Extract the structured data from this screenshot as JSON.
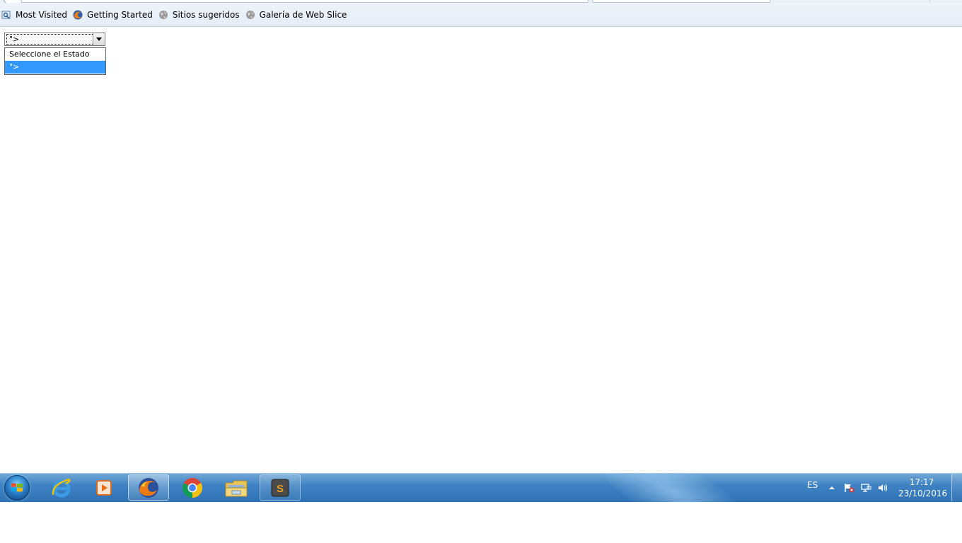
{
  "bookmarks": [
    {
      "label": "Most Visited",
      "icon": "most-visited-icon"
    },
    {
      "label": "Getting Started",
      "icon": "firefox-icon"
    },
    {
      "label": "Sitios sugeridos",
      "icon": "globe-icon"
    },
    {
      "label": "Galería de Web Slice",
      "icon": "globe-icon"
    }
  ],
  "select": {
    "current_value": "\">",
    "options": [
      "Seleccione el Estado",
      "\">"
    ],
    "selected_index": 1
  },
  "taskbar": {
    "apps": [
      {
        "name": "internet-explorer-icon",
        "state": "pinned"
      },
      {
        "name": "media-player-icon",
        "state": "pinned"
      },
      {
        "name": "firefox-icon",
        "state": "active"
      },
      {
        "name": "chrome-icon",
        "state": "pinned"
      },
      {
        "name": "file-explorer-icon",
        "state": "pinned"
      },
      {
        "name": "sublime-text-icon",
        "state": "running"
      }
    ],
    "language": "ES",
    "time": "17:17",
    "date": "23/10/2016"
  },
  "colors": {
    "selection_highlight": "#3399ff",
    "taskbar": "#2d72b5"
  }
}
